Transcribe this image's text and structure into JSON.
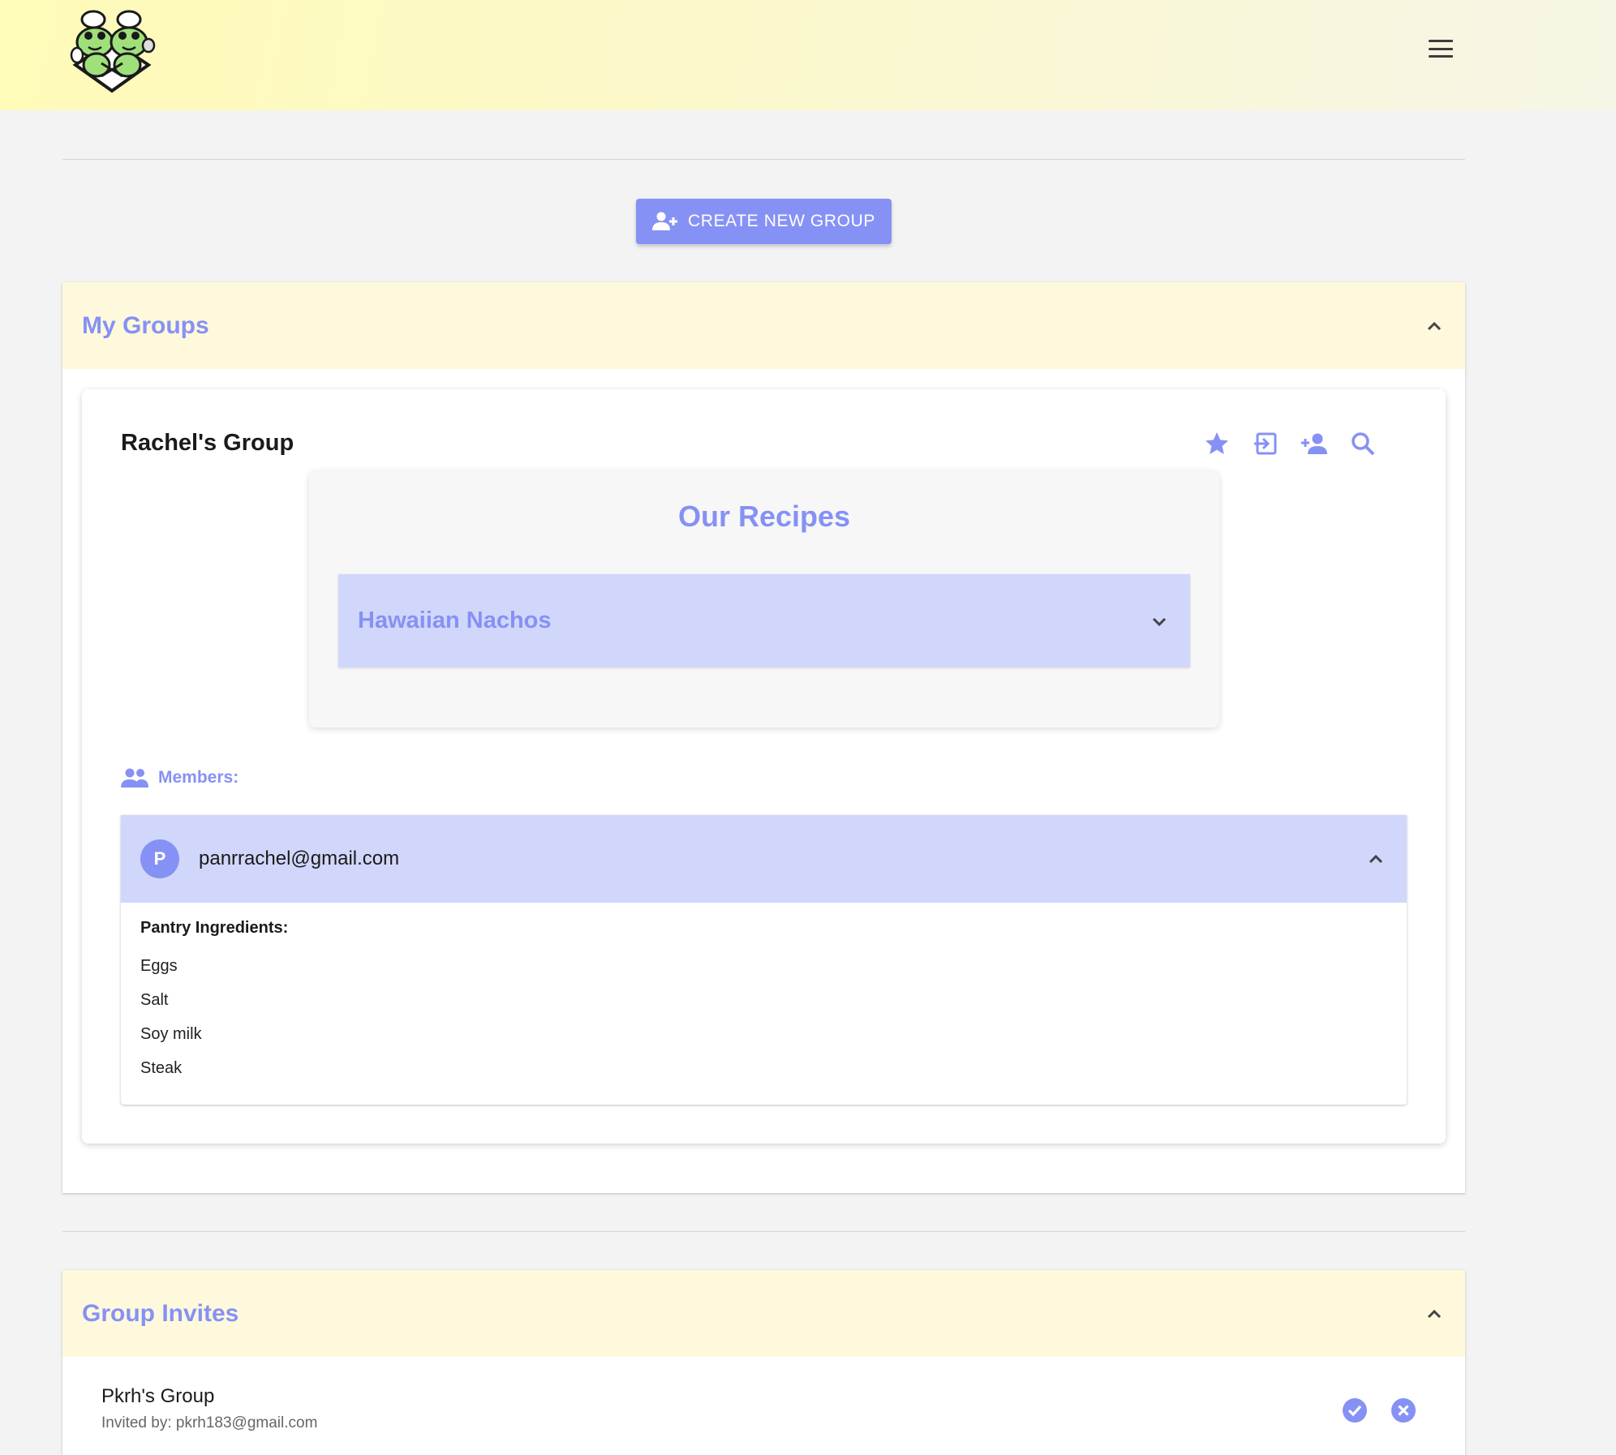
{
  "header": {
    "logo_icon": "frog-chefs-logo",
    "menu_icon": "hamburger-menu-icon"
  },
  "actions": {
    "create_group_label": "CREATE NEW GROUP"
  },
  "my_groups": {
    "title": "My Groups",
    "expanded": true,
    "group": {
      "name": "Rachel's Group",
      "icons": [
        "star-icon",
        "exit-icon",
        "add-member-icon",
        "search-icon"
      ],
      "recipes_title": "Our Recipes",
      "recipes": [
        {
          "name": "Hawaiian Nachos"
        }
      ],
      "members_label": "Members:",
      "members": [
        {
          "initial": "P",
          "email": "panrrachel@gmail.com",
          "pantry_label": "Pantry Ingredients:",
          "pantry": [
            "Eggs",
            "Salt",
            "Soy milk",
            "Steak"
          ]
        }
      ]
    }
  },
  "group_invites": {
    "title": "Group Invites",
    "expanded": true,
    "invites": [
      {
        "group_name": "Pkrh's Group",
        "invited_by": "Invited by: pkrh183@gmail.com"
      }
    ]
  },
  "colors": {
    "accent": "#8691f5",
    "accent_light": "#d1d7fb",
    "section_header": "#fef9dc"
  }
}
